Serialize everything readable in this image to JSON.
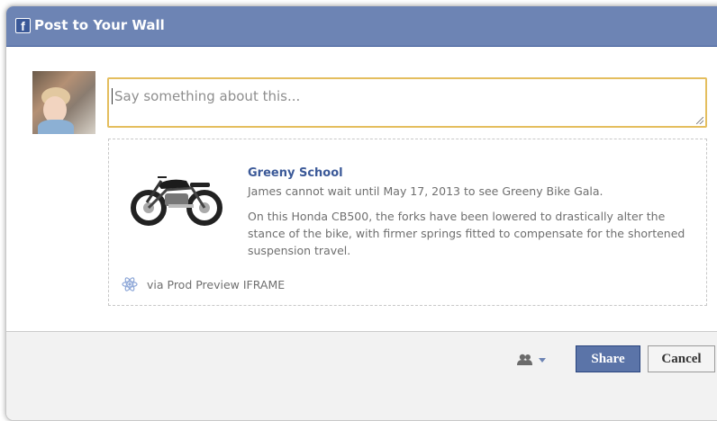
{
  "dialog": {
    "title": "Post to Your Wall",
    "logo_letter": "f"
  },
  "composer": {
    "placeholder": "Say something about this..."
  },
  "attachment": {
    "title": "Greeny School",
    "caption": "James cannot wait until May 17, 2013 to see Greeny Bike Gala.",
    "description": "On this Honda CB500, the forks have been lowered to drastically alter the stance of the bike, with firmer springs fitted to compensate for the shortened suspension travel.",
    "via": "via Prod Preview IFRAME"
  },
  "footer": {
    "share_label": "Share",
    "cancel_label": "Cancel"
  },
  "icons": {
    "logo": "facebook-logo-icon",
    "resize": "resize-handle-icon",
    "thumbnail": "motorcycle-thumbnail",
    "via": "app-atom-icon",
    "audience": "friends-audience-icon",
    "dropdown": "chevron-down-icon"
  },
  "colors": {
    "header": "#6d84b4",
    "link": "#3b5998",
    "focus_border": "#e4be5e",
    "share_button": "#5b74a8"
  }
}
